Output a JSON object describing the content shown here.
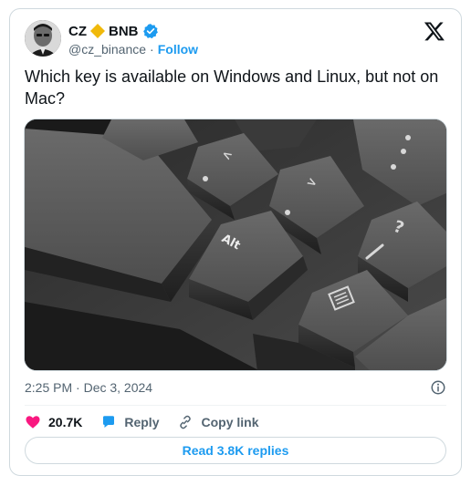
{
  "author": {
    "name": "CZ",
    "ticker": "BNB",
    "handle": "@cz_binance",
    "separator": "·",
    "follow_label": "Follow"
  },
  "tweet": {
    "text": "Which key is available on Windows and Linux, but not on Mac?",
    "image_key_labels": [
      "Alt",
      "<",
      ">",
      "?",
      "/"
    ]
  },
  "meta": {
    "timestamp": "2:25 PM · Dec 3, 2024"
  },
  "actions": {
    "likes": "20.7K",
    "reply_label": "Reply",
    "copy_link_label": "Copy link"
  },
  "read_replies_label": "Read 3.8K replies",
  "colors": {
    "accent": "#1d9bf0",
    "like": "#f91880",
    "diamond": "#f0b90b",
    "text": "#0f1419",
    "secondary": "#536471"
  },
  "icons": [
    "diamond-icon",
    "verified-icon",
    "x-logo-icon",
    "info-icon",
    "heart-icon",
    "reply-icon",
    "link-icon"
  ]
}
